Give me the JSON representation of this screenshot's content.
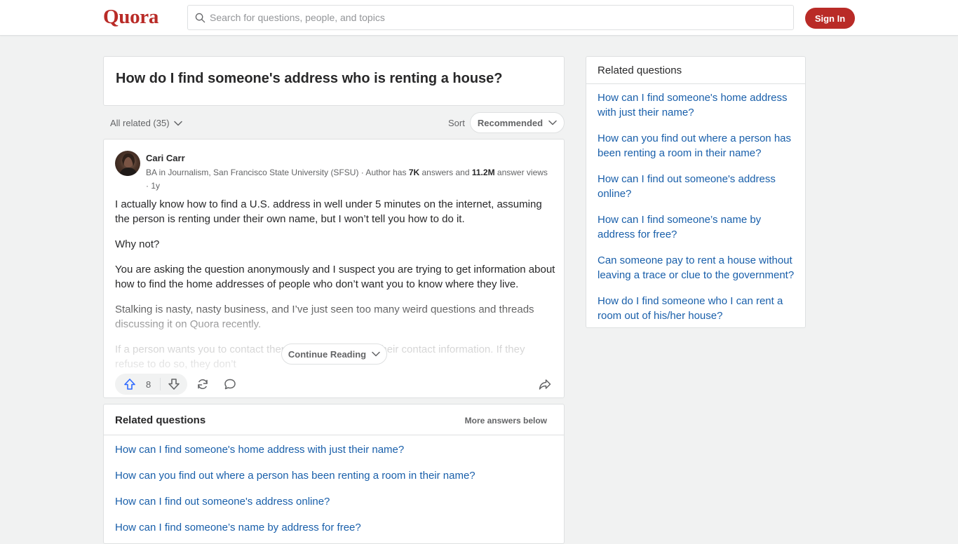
{
  "header": {
    "logo": "Quora",
    "search_placeholder": "Search for questions, people, and topics",
    "signin_label": "Sign In"
  },
  "question": {
    "title": "How do I find someone's address who is renting a house?"
  },
  "filters": {
    "all_related_label": "All related (35)",
    "sort_label": "Sort",
    "sort_value": "Recommended"
  },
  "answer": {
    "author_name": "Cari Carr",
    "credential_prefix": "BA in Journalism, San Francisco State University (SFSU) · Author has ",
    "answers_count": "7K",
    "credential_mid": " answers and ",
    "views_count": "11.2M",
    "credential_suffix": " answer views · 1y",
    "paragraphs": [
      "I actually know how to find a U.S. address in well under 5 minutes on the internet, assuming the person is renting under their own name, but I won’t tell you how to do it.",
      "Why not?",
      "You are asking the question anonymously and I suspect you are trying to get information about how to find the home addresses of people who don’t want you to know where they live.",
      "Stalking is nasty, nasty business, and I’ve just seen too many weird questions and threads discussing it on Quora recently.",
      "If a person wants you to contact them, they will give you their contact information. If they refuse to do so, they don’t"
    ],
    "continue_label": "Continue Reading",
    "upvotes": "8"
  },
  "related_bottom": {
    "title": "Related questions",
    "more_label": "More answers below",
    "items": [
      "How can I find someone's home address with just their name?",
      "How can you find out where a person has been renting a room in their name?",
      "How can I find out someone's address online?",
      "How can I find someone’s name by address for free?"
    ]
  },
  "sidebar": {
    "title": "Related questions",
    "items": [
      "How can I find someone's home address with just their name?",
      "How can you find out where a person has been renting a room in their name?",
      "How can I find out someone's address online?",
      "How can I find someone’s name by address for free?",
      "Can someone pay to rent a house without leaving a trace or clue to the government?",
      "How do I find someone who I can rent a room out of his/her house?"
    ]
  },
  "colors": {
    "brand": "#b92b27",
    "link": "#195faa",
    "background": "#f1f2f2"
  }
}
